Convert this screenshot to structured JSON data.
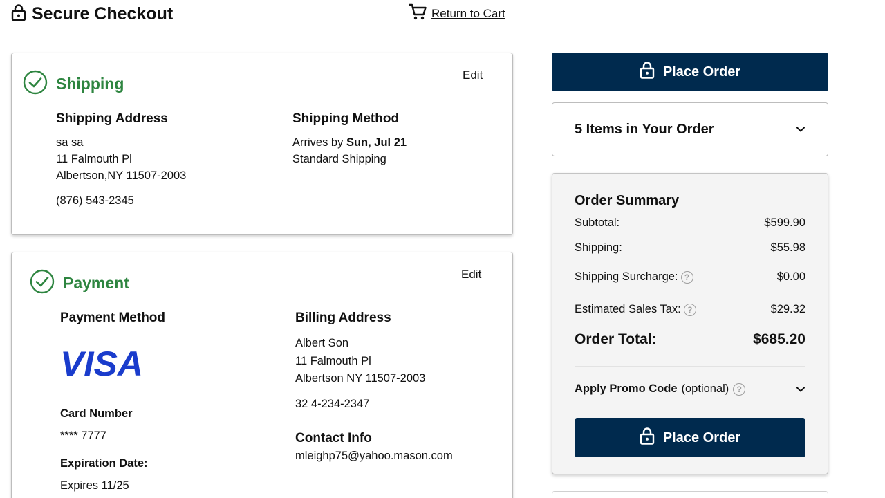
{
  "header": {
    "title": "Secure Checkout",
    "lock_icon": "lock-icon",
    "return_link": "Return to Cart",
    "cart_icon": "cart-icon"
  },
  "shipping": {
    "heading": "Shipping",
    "status_icon": "check-circle-icon",
    "edit": "Edit",
    "address_heading": "Shipping Address",
    "address": {
      "name": "sa sa",
      "street": "11 Falmouth Pl",
      "city_state_zip": "Albertson,NY 11507-2003",
      "phone": "(876) 543-2345"
    },
    "method_heading": "Shipping Method",
    "method": {
      "arrives_prefix": "Arrives by",
      "arrives_date": "Sun, Jul 21",
      "name": "Standard Shipping"
    }
  },
  "payment": {
    "heading": "Payment",
    "status_icon": "check-circle-icon",
    "edit": "Edit",
    "method_heading": "Payment Method",
    "card_brand": "VISA",
    "card_number_label": "Card Number",
    "card_number": "**** 7777",
    "expiration_label": "Expiration Date:",
    "expiration": "Expires 11/25",
    "billing_heading": "Billing Address",
    "billing": {
      "name": "Albert Son",
      "street": "11 Falmouth Pl",
      "city_state_zip": "Albertson NY 11507-2003",
      "phone": "32 4-234-2347"
    },
    "contact_heading": "Contact Info",
    "email": "mleighp75@yahoo.mason.com"
  },
  "order": {
    "place_order_label": "Place Order",
    "items_label": "5 Items in Your Order",
    "summary": {
      "title": "Order Summary",
      "subtotal_label": "Subtotal:",
      "subtotal": "$599.90",
      "shipping_label": "Shipping:",
      "shipping": "$55.98",
      "surcharge_label": "Shipping Surcharge:",
      "surcharge": "$0.00",
      "tax_label": "Estimated Sales Tax:",
      "tax": "$29.32",
      "total_label": "Order Total:",
      "total": "$685.20",
      "promo_label": "Apply Promo Code",
      "promo_optional": "(optional)"
    }
  },
  "colors": {
    "accent_green": "#2e8540",
    "navy": "#002a4e",
    "visa_blue": "#1a3ccc"
  }
}
